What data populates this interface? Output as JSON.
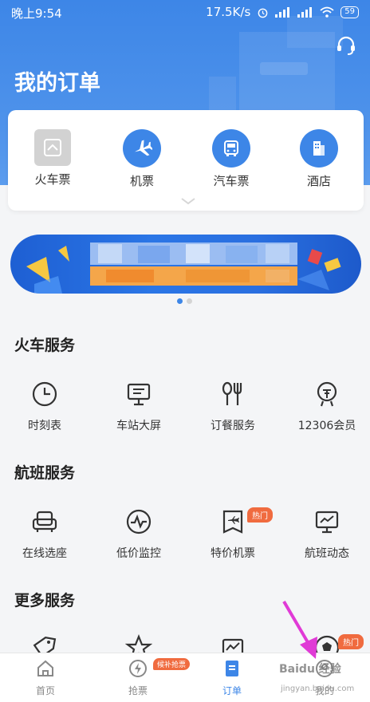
{
  "status_bar": {
    "time": "晚上9:54",
    "network_speed": "17.5K/s",
    "battery": "59"
  },
  "header": {
    "title": "我的订单"
  },
  "categories": [
    {
      "label": "火车票",
      "icon": "train-icon",
      "color": "#cfcfcf"
    },
    {
      "label": "机票",
      "icon": "plane-icon",
      "color": "#3d86e7"
    },
    {
      "label": "汽车票",
      "icon": "bus-icon",
      "color": "#3d86e7"
    },
    {
      "label": "酒店",
      "icon": "hotel-icon",
      "color": "#3d86e7"
    }
  ],
  "train_services": {
    "title": "火车服务",
    "items": [
      {
        "label": "时刻表",
        "icon": "clock-icon"
      },
      {
        "label": "车站大屏",
        "icon": "monitor-icon"
      },
      {
        "label": "订餐服务",
        "icon": "cutlery-icon"
      },
      {
        "label": "12306会员",
        "icon": "member-icon"
      }
    ]
  },
  "flight_services": {
    "title": "航班服务",
    "items": [
      {
        "label": "在线选座",
        "icon": "seat-icon"
      },
      {
        "label": "低价监控",
        "icon": "pulse-icon"
      },
      {
        "label": "特价机票",
        "icon": "ticket-icon",
        "badge": "热门"
      },
      {
        "label": "航班动态",
        "icon": "flight-status-icon"
      }
    ]
  },
  "more_services": {
    "title": "更多服务",
    "items": [
      {
        "label": "",
        "icon": "tag-icon"
      },
      {
        "label": "",
        "icon": "star-icon"
      },
      {
        "label": "",
        "icon": "chart-icon"
      },
      {
        "label": "",
        "icon": "ball-icon",
        "badge": "热门"
      }
    ]
  },
  "tabbar": {
    "items": [
      {
        "label": "首页",
        "icon": "home-icon"
      },
      {
        "label": "抢票",
        "icon": "lightning-icon",
        "badge": "候补抢票"
      },
      {
        "label": "订单",
        "icon": "order-icon",
        "active": true
      },
      {
        "label": "我的",
        "icon": "profile-icon"
      }
    ]
  },
  "watermark": {
    "text": "Baidu 经验",
    "url": "jingyan.baidu.com"
  },
  "colors": {
    "primary": "#3d86e7",
    "badge": "#f06b3f"
  }
}
